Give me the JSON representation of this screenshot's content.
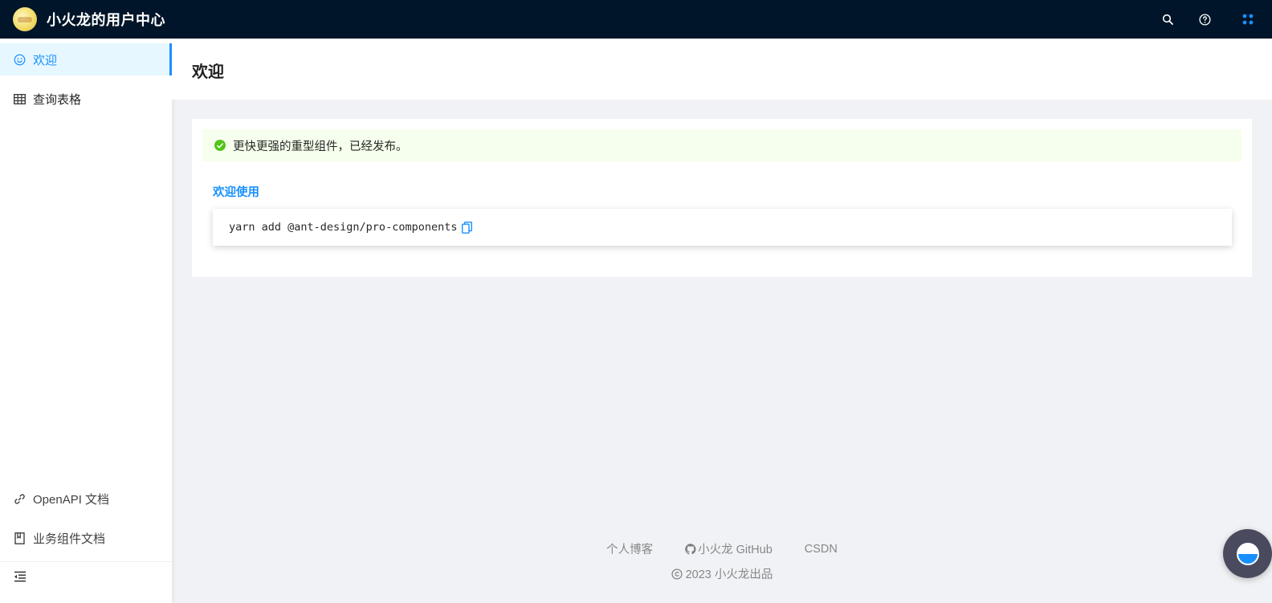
{
  "header": {
    "app_title": "小火龙的用户中心",
    "icons": [
      "search-icon",
      "question-circle-icon",
      "apps-icon"
    ],
    "background": "#001529"
  },
  "sidebar": {
    "items": [
      {
        "label": "欢迎",
        "icon": "smile-icon",
        "active": true
      },
      {
        "label": "查询表格",
        "icon": "table-icon",
        "active": false
      }
    ],
    "bottom_items": [
      {
        "label": "OpenAPI 文档",
        "icon": "link-icon"
      },
      {
        "label": "业务组件文档",
        "icon": "book-icon"
      }
    ],
    "collapse_icon": "menu-fold-icon"
  },
  "page": {
    "title": "欢迎"
  },
  "content": {
    "alert_text": "更快更强的重型组件，已经发布。",
    "welcome_label": "欢迎使用",
    "code_text": "yarn add @ant-design/pro-components",
    "copy_icon": "copy-icon"
  },
  "footer": {
    "links": [
      {
        "label": "个人博客"
      },
      {
        "label": "小火龙 GitHub",
        "icon": "github-icon"
      },
      {
        "label": "CSDN"
      }
    ],
    "copyright": "2023 小火龙出品"
  },
  "colors": {
    "primary": "#1890ff",
    "success": "#52c41a",
    "alert_bg": "#f6ffed",
    "page_bg": "#f0f2f5"
  }
}
